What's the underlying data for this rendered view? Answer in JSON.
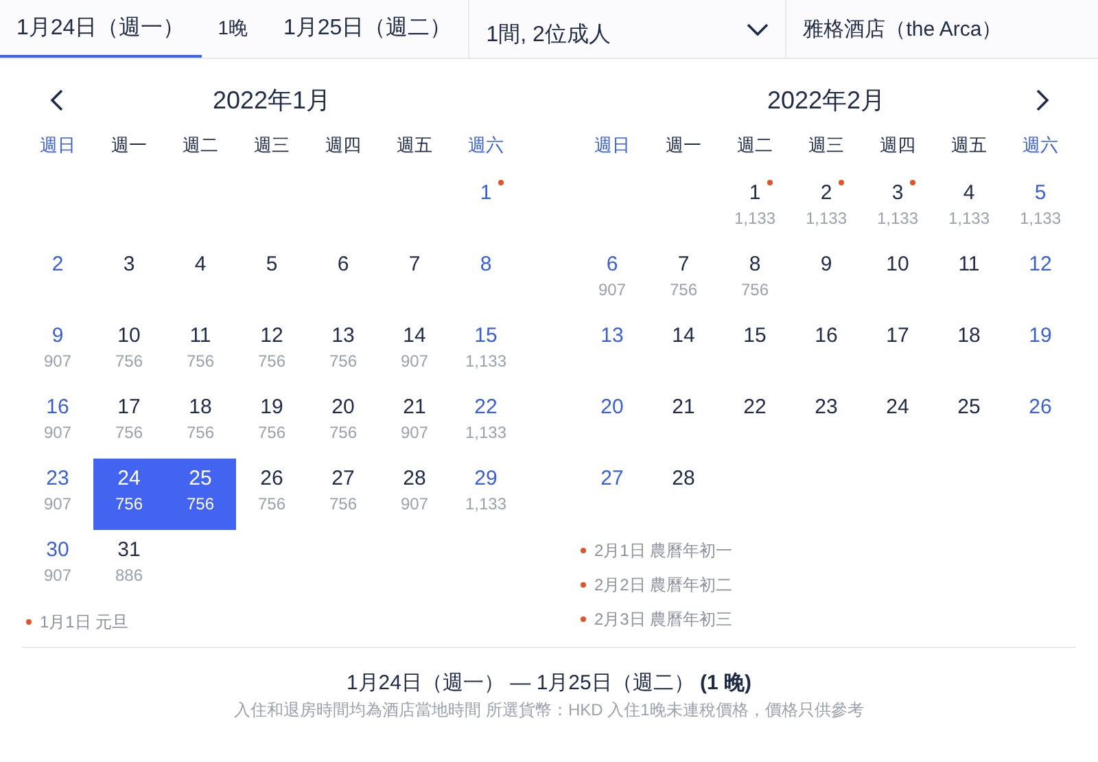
{
  "search_bar": {
    "check_in": {
      "label": "1月24日（週一）",
      "selected": true
    },
    "nights": "1晚",
    "check_out": {
      "label": "1月25日（週二）",
      "selected": false
    },
    "guests": "1間, 2位成人",
    "hotel": "雅格酒店（the Arca）"
  },
  "months": [
    {
      "title": "2022年1月",
      "prev_button": true,
      "weekdays": [
        "週日",
        "週一",
        "週二",
        "週三",
        "週四",
        "週五",
        "週六"
      ],
      "weeks": [
        [
          {
            "day": "1",
            "holiday": true,
            "selected": false
          }
        ],
        [
          {
            "day": "2",
            "holiday": false,
            "selected": false
          },
          {
            "day": "3",
            "holiday": false,
            "selected": false
          },
          {
            "day": "4",
            "holiday": false,
            "selected": false
          },
          {
            "day": "5",
            "holiday": false,
            "selected": false
          },
          {
            "day": "6",
            "holiday": false,
            "selected": false
          },
          {
            "day": "7",
            "holiday": false,
            "selected": false
          },
          {
            "day": "8",
            "holiday": false,
            "selected": false
          }
        ],
        [
          {
            "day": "9",
            "price": "907",
            "holiday": false,
            "selected": false
          },
          {
            "day": "10",
            "price": "756",
            "holiday": false,
            "selected": false
          },
          {
            "day": "11",
            "price": "756",
            "holiday": false,
            "selected": false
          },
          {
            "day": "12",
            "price": "756",
            "holiday": false,
            "selected": false
          },
          {
            "day": "13",
            "price": "756",
            "holiday": false,
            "selected": false
          },
          {
            "day": "14",
            "price": "907",
            "holiday": false,
            "selected": false
          },
          {
            "day": "15",
            "price": "1,133",
            "holiday": false,
            "selected": false
          }
        ],
        [
          {
            "day": "16",
            "price": "907",
            "holiday": false,
            "selected": false
          },
          {
            "day": "17",
            "price": "756",
            "holiday": false,
            "selected": false
          },
          {
            "day": "18",
            "price": "756",
            "holiday": false,
            "selected": false
          },
          {
            "day": "19",
            "price": "756",
            "holiday": false,
            "selected": false
          },
          {
            "day": "20",
            "price": "756",
            "holiday": false,
            "selected": false
          },
          {
            "day": "21",
            "price": "907",
            "holiday": false,
            "selected": false
          },
          {
            "day": "22",
            "price": "1,133",
            "holiday": false,
            "selected": false
          }
        ],
        [
          {
            "day": "23",
            "price": "907",
            "holiday": false,
            "selected": false
          },
          {
            "day": "24",
            "price": "756",
            "holiday": false,
            "selected": true
          },
          {
            "day": "25",
            "price": "756",
            "holiday": false,
            "selected": true
          },
          {
            "day": "26",
            "price": "756",
            "holiday": false,
            "selected": false
          },
          {
            "day": "27",
            "price": "756",
            "holiday": false,
            "selected": false
          },
          {
            "day": "28",
            "price": "907",
            "holiday": false,
            "selected": false
          },
          {
            "day": "29",
            "price": "1,133",
            "holiday": false,
            "selected": false
          }
        ],
        [
          {
            "day": "30",
            "price": "907",
            "holiday": false,
            "selected": false
          },
          {
            "day": "31",
            "price": "886",
            "holiday": false,
            "selected": false
          }
        ]
      ],
      "holidays": [
        "1月1日 元旦"
      ]
    },
    {
      "title": "2022年2月",
      "next_button": true,
      "weekdays": [
        "週日",
        "週一",
        "週二",
        "週三",
        "週四",
        "週五",
        "週六"
      ],
      "weeks": [
        [
          {
            "day": "1",
            "price": "1,133",
            "holiday": true,
            "selected": false
          },
          {
            "day": "2",
            "price": "1,133",
            "holiday": true,
            "selected": false
          },
          {
            "day": "3",
            "price": "1,133",
            "holiday": true,
            "selected": false
          },
          {
            "day": "4",
            "price": "1,133",
            "holiday": false,
            "selected": false
          },
          {
            "day": "5",
            "price": "1,133",
            "holiday": false,
            "selected": false
          }
        ],
        [
          {
            "day": "6",
            "price": "907",
            "holiday": false,
            "selected": false
          },
          {
            "day": "7",
            "price": "756",
            "holiday": false,
            "selected": false
          },
          {
            "day": "8",
            "price": "756",
            "holiday": false,
            "selected": false
          },
          {
            "day": "9",
            "holiday": false,
            "selected": false
          },
          {
            "day": "10",
            "holiday": false,
            "selected": false
          },
          {
            "day": "11",
            "holiday": false,
            "selected": false
          },
          {
            "day": "12",
            "holiday": false,
            "selected": false
          }
        ],
        [
          {
            "day": "13",
            "holiday": false,
            "selected": false
          },
          {
            "day": "14",
            "holiday": false,
            "selected": false
          },
          {
            "day": "15",
            "holiday": false,
            "selected": false
          },
          {
            "day": "16",
            "holiday": false,
            "selected": false
          },
          {
            "day": "17",
            "holiday": false,
            "selected": false
          },
          {
            "day": "18",
            "holiday": false,
            "selected": false
          },
          {
            "day": "19",
            "holiday": false,
            "selected": false
          }
        ],
        [
          {
            "day": "20",
            "holiday": false,
            "selected": false
          },
          {
            "day": "21",
            "holiday": false,
            "selected": false
          },
          {
            "day": "22",
            "holiday": false,
            "selected": false
          },
          {
            "day": "23",
            "holiday": false,
            "selected": false
          },
          {
            "day": "24",
            "holiday": false,
            "selected": false
          },
          {
            "day": "25",
            "holiday": false,
            "selected": false
          },
          {
            "day": "26",
            "holiday": false,
            "selected": false
          }
        ],
        [
          {
            "day": "27",
            "holiday": false,
            "selected": false
          },
          {
            "day": "28",
            "holiday": false,
            "selected": false
          }
        ]
      ],
      "holidays": [
        "2月1日 農曆年初一",
        "2月2日 農曆年初二",
        "2月3日 農曆年初三"
      ]
    }
  ],
  "summary": {
    "range": "1月24日（週一） — 1月25日（週二） **(1 晚)**",
    "note": "入住和退房時間均為酒店當地時間 所選貨幣：HKD 入住1晚未連稅價格，價格只供參考"
  }
}
